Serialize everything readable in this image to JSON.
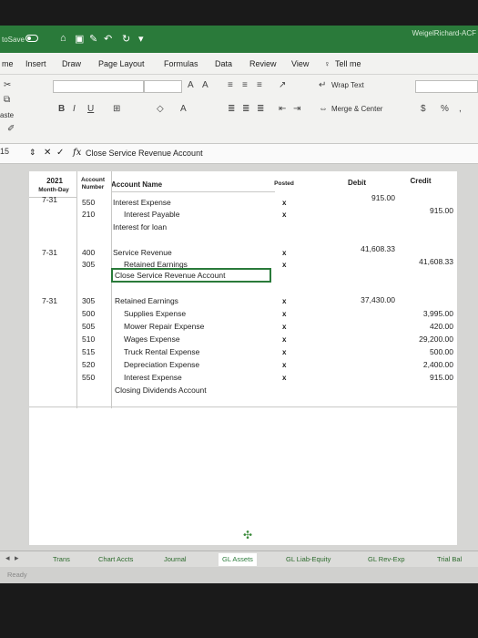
{
  "titlebar": {
    "autosave_label": "toSave",
    "user": "WeigelRichard-ACF"
  },
  "tabs": [
    "me",
    "Insert",
    "Draw",
    "Page Layout",
    "Formulas",
    "Data",
    "Review",
    "View",
    "Tell me"
  ],
  "ribbon": {
    "wrap_text": "Wrap Text",
    "merge_center": "Merge & Center",
    "paste": "aste",
    "currency": "$",
    "percent": "%",
    "bold": "B",
    "italic": "I",
    "underline": "U"
  },
  "formula_bar": {
    "name_box": "15",
    "content": "Close Service Revenue Account"
  },
  "sheet": {
    "headers": {
      "year": "2021",
      "month_day": "Month-Day",
      "account_number": "Account Number",
      "account_name": "Account Name",
      "posted": "Posted",
      "debit": "Debit",
      "credit": "Credit"
    },
    "entries": [
      {
        "date": "7-31",
        "rows": [
          {
            "number": "550",
            "name": "Interest Expense",
            "posted": "x",
            "debit": "915.00",
            "credit": ""
          },
          {
            "number": "210",
            "name": "Interest Payable",
            "posted": "x",
            "debit": "",
            "credit": "915.00"
          }
        ],
        "memo": "Interest for loan"
      },
      {
        "date": "7-31",
        "rows": [
          {
            "number": "400",
            "name": "Service Revenue",
            "posted": "x",
            "debit": "41,608.33",
            "credit": ""
          },
          {
            "number": "305",
            "name": "Retained Earnings",
            "posted": "x",
            "debit": "",
            "credit": "41,608.33"
          }
        ],
        "memo": "Close Service Revenue Account"
      },
      {
        "date": "7-31",
        "rows": [
          {
            "number": "305",
            "name": "Retained Earnings",
            "posted": "x",
            "debit": "37,430.00",
            "credit": ""
          },
          {
            "number": "500",
            "name": "Supplies Expense",
            "posted": "x",
            "debit": "",
            "credit": "3,995.00"
          },
          {
            "number": "505",
            "name": "Mower Repair Expense",
            "posted": "x",
            "debit": "",
            "credit": "420.00"
          },
          {
            "number": "510",
            "name": "Wages Expense",
            "posted": "x",
            "debit": "",
            "credit": "29,200.00"
          },
          {
            "number": "515",
            "name": "Truck Rental Expense",
            "posted": "x",
            "debit": "",
            "credit": "500.00"
          },
          {
            "number": "520",
            "name": "Depreciation Expense",
            "posted": "x",
            "debit": "",
            "credit": "2,400.00"
          },
          {
            "number": "550",
            "name": "Interest Expense",
            "posted": "x",
            "debit": "",
            "credit": "915.00"
          }
        ],
        "memo": "Closing Dividends Account"
      }
    ]
  },
  "sheet_tabs": [
    "Trans",
    "Chart Accts",
    "Journal",
    "GL Assets",
    "GL Liab-Equity",
    "GL Rev-Exp",
    "Trial Bal"
  ],
  "status": "Ready"
}
